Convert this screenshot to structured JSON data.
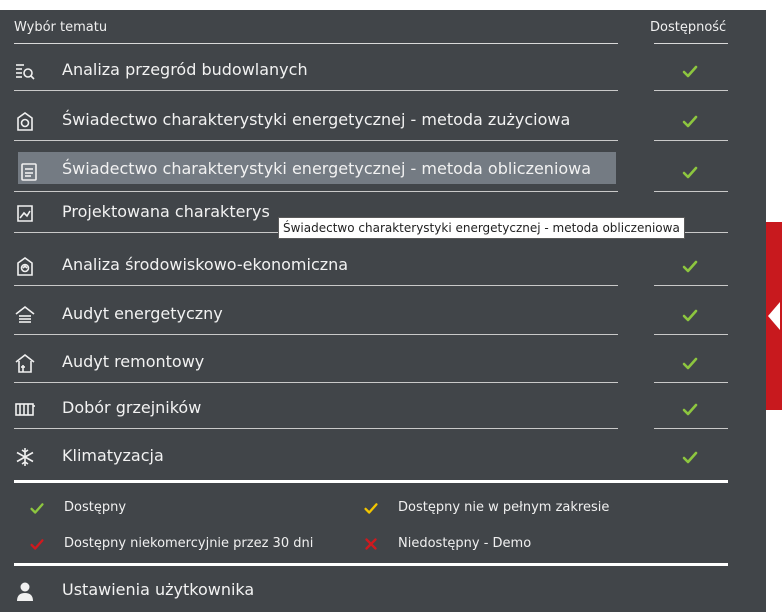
{
  "header": {
    "topic_label": "Wybór tematu",
    "availability_label": "Dostępność"
  },
  "topics": [
    {
      "label": "Analiza przegród budowlanych",
      "icon": "wall-analysis-icon",
      "status": "available"
    },
    {
      "label": "Świadectwo charakterystyki energetycznej - metoda zużyciowa",
      "icon": "energy-certificate-consumption-icon",
      "status": "available"
    },
    {
      "label": "Świadectwo charakterystyki energetycznej - metoda obliczeniowa",
      "icon": "energy-certificate-calculation-icon",
      "status": "available",
      "selected": true
    },
    {
      "label": "Projektowana charakterys",
      "icon": "designed-characteristic-icon",
      "status": "available"
    },
    {
      "label": "Analiza środowiskowo-ekonomiczna",
      "icon": "environmental-economic-icon",
      "status": "available"
    },
    {
      "label": "Audyt energetyczny",
      "icon": "energy-audit-icon",
      "status": "available"
    },
    {
      "label": "Audyt remontowy",
      "icon": "renovation-audit-icon",
      "status": "available"
    },
    {
      "label": "Dobór grzejników",
      "icon": "radiator-icon",
      "status": "available"
    },
    {
      "label": "Klimatyzacja",
      "icon": "snowflake-icon",
      "status": "available"
    }
  ],
  "tooltip": "Świadectwo charakterystyki energetycznej - metoda obliczeniowa",
  "legend": {
    "available": "Dostępny",
    "partial": "Dostępny nie w pełnym zakresie",
    "noncommercial": "Dostępny niekomercyjnie przez 30 dni",
    "unavailable": "Niedostępny - Demo"
  },
  "user_settings": "Ustawienia użytkownika",
  "colors": {
    "panel": "#414549",
    "check_green": "#8dc63f",
    "check_yellow": "#f2c500",
    "check_red": "#d0191e",
    "accent_red": "#c8191e",
    "selected_row": "#747b83"
  }
}
